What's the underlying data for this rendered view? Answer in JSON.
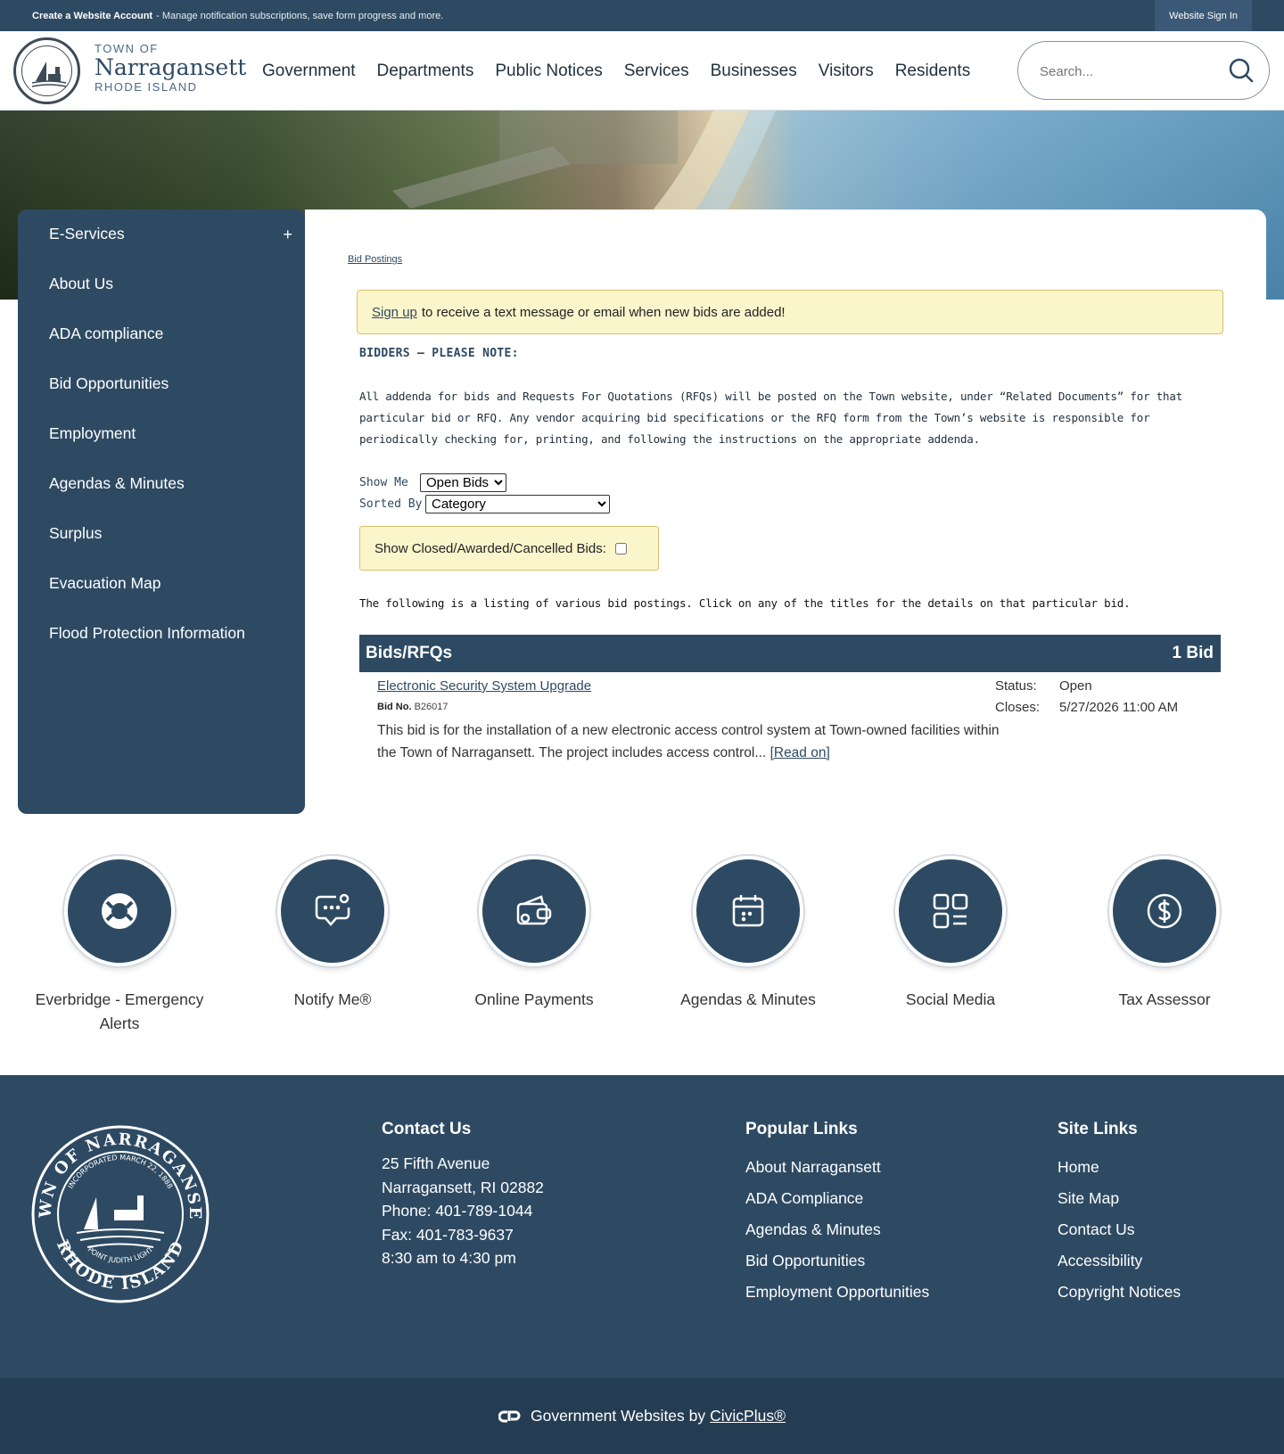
{
  "topbar": {
    "create_account": "Create a Website Account",
    "create_desc": "- Manage notification subscriptions, save form progress and more.",
    "sign_in": "Website Sign In"
  },
  "brand": {
    "town_of": "TOWN OF",
    "name": "Narragansett",
    "state": "RHODE ISLAND"
  },
  "nav": {
    "items": [
      "Government",
      "Departments",
      "Public Notices",
      "Services",
      "Businesses",
      "Visitors",
      "Residents"
    ]
  },
  "search": {
    "placeholder": "Search..."
  },
  "sidebar": {
    "items": [
      "E-Services",
      "About Us",
      "ADA compliance",
      "Bid Opportunities",
      "Employment",
      "Agendas & Minutes",
      "Surplus",
      "Evacuation Map",
      "Flood Protection Information"
    ],
    "expand_symbol": "+"
  },
  "main": {
    "breadcrumb": "Bid Postings",
    "notice_link": "Sign up",
    "notice_text": "to receive a text message or email when new bids are added!",
    "note_title": "BIDDERS – PLEASE NOTE:",
    "note_body": "All addenda for bids and Requests For Quotations (RFQs) will be posted on the Town website, under “Related Documents” for that particular bid or RFQ. Any vendor acquiring bid specifications or the RFQ form from the Town’s website is responsible for periodically checking for, printing, and following the instructions on the appropriate addenda.",
    "show_me_label": "Show Me",
    "show_me_value": "Open Bids",
    "sorted_by_label": "Sorted By",
    "sorted_by_value": "Category",
    "closed_label": "Show Closed/Awarded/Cancelled Bids:",
    "listing_desc": "The following is a listing of various bid postings. Click on any of the titles for the details on that particular bid.",
    "table_title": "Bids/RFQs",
    "table_count": "1 Bid"
  },
  "bid": {
    "title": "Electronic Security System Upgrade",
    "no_label": "Bid No.",
    "no": "B26017",
    "desc": "This bid is for the installation of a new electronic access control system at Town-owned facilities within the Town of Narragansett. The project includes access control...",
    "read_on": "[Read on]",
    "status_label": "Status:",
    "status": "Open",
    "closes_label": "Closes:",
    "closes": "5/27/2026 11:00 AM"
  },
  "quick_links": [
    {
      "label": "Everbridge - Emergency Alerts",
      "icon": "lifebuoy-icon"
    },
    {
      "label": "Notify Me®",
      "icon": "chat-notify-icon"
    },
    {
      "label": "Online Payments",
      "icon": "wallet-icon"
    },
    {
      "label": "Agendas & Minutes",
      "icon": "calendar-icon"
    },
    {
      "label": "Social Media",
      "icon": "grid-icon"
    },
    {
      "label": "Tax Assessor",
      "icon": "dollar-icon"
    }
  ],
  "footer": {
    "contact_title": "Contact Us",
    "address1": "25 Fifth Avenue",
    "address2": "Narragansett, RI 02882",
    "phone": "Phone: 401-789-1044",
    "fax": "Fax: 401-783-9637",
    "hours": "8:30 am to 4:30 pm",
    "popular_title": "Popular Links",
    "popular": [
      "About Narragansett",
      "ADA Compliance",
      "Agendas & Minutes",
      "Bid Opportunities",
      "Employment Opportunities"
    ],
    "site_title": "Site Links",
    "site": [
      "Home",
      "Site Map",
      "Contact Us",
      "Accessibility",
      "Copyright Notices"
    ],
    "seal_top": "TOWN OF NARRAGANSETT",
    "seal_bottom": "RHODE ISLAND",
    "seal_inner_top": "INCORPORATED MARCH 22, 1888",
    "seal_inner_bottom": "POINT JUDITH LIGHT"
  },
  "bottom": {
    "text": "Government Websites by",
    "link": "CivicPlus®"
  },
  "colors": {
    "primary": "#2e4a63",
    "notice_bg": "#fbf5cc",
    "footer_bottom": "#253d52"
  }
}
